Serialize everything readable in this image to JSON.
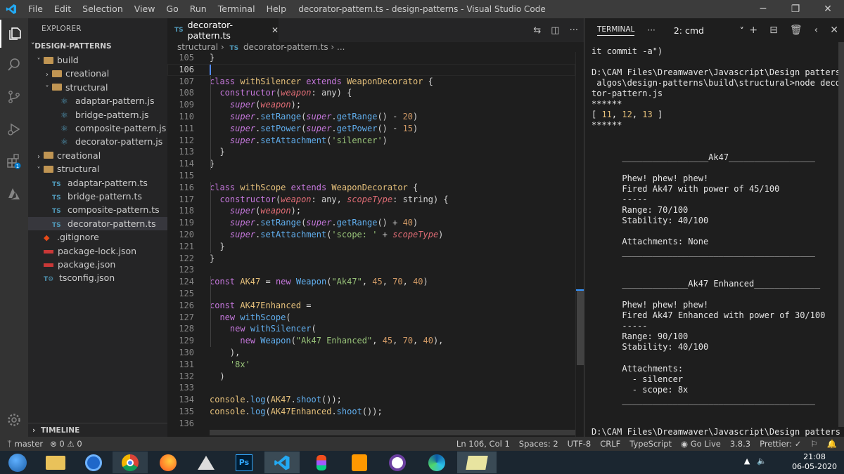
{
  "titlebar": {
    "menu": [
      "File",
      "Edit",
      "Selection",
      "View",
      "Go",
      "Run",
      "Terminal",
      "Help"
    ],
    "window_title": "decorator-pattern.ts - design-patterns - Visual Studio Code",
    "minimize": "─",
    "restore": "❐",
    "close": "✕"
  },
  "sidebar": {
    "header": "EXPLORER",
    "section": "DESIGN-PATTERNS",
    "timeline": "TIMELINE",
    "tree": [
      {
        "label": "build",
        "kind": "folder",
        "open": true,
        "depth": 1
      },
      {
        "label": "creational",
        "kind": "folder",
        "open": false,
        "depth": 2
      },
      {
        "label": "structural",
        "kind": "folder",
        "open": true,
        "depth": 2
      },
      {
        "label": "adaptar-pattern.js",
        "kind": "js",
        "depth": 3
      },
      {
        "label": "bridge-pattern.js",
        "kind": "js",
        "depth": 3
      },
      {
        "label": "composite-pattern.js",
        "kind": "js",
        "depth": 3
      },
      {
        "label": "decorator-pattern.js",
        "kind": "js",
        "depth": 3
      },
      {
        "label": "creational",
        "kind": "folder",
        "open": false,
        "depth": 1
      },
      {
        "label": "structural",
        "kind": "folder",
        "open": true,
        "depth": 1
      },
      {
        "label": "adaptar-pattern.ts",
        "kind": "ts",
        "depth": 2
      },
      {
        "label": "bridge-pattern.ts",
        "kind": "ts",
        "depth": 2
      },
      {
        "label": "composite-pattern.ts",
        "kind": "ts",
        "depth": 2
      },
      {
        "label": "decorator-pattern.ts",
        "kind": "ts",
        "depth": 2,
        "selected": true
      },
      {
        "label": ".gitignore",
        "kind": "git",
        "depth": 1
      },
      {
        "label": "package-lock.json",
        "kind": "npm",
        "depth": 1
      },
      {
        "label": "package.json",
        "kind": "npm",
        "depth": 1
      },
      {
        "label": "tsconfig.json",
        "kind": "tsconfig",
        "depth": 1
      }
    ]
  },
  "editor": {
    "tab_label": "decorator-pattern.ts",
    "tab_icon": "TS",
    "breadcrumb": [
      "structural",
      "decorator-pattern.ts",
      "..."
    ],
    "current_line": "106",
    "lines": [
      {
        "n": "105",
        "tokens": [
          [
            "pln",
            "}"
          ]
        ]
      },
      {
        "n": "106",
        "tokens": []
      },
      {
        "n": "107",
        "tokens": [
          [
            "kw",
            "class "
          ],
          [
            "cls",
            "withSilencer "
          ],
          [
            "kw",
            "extends "
          ],
          [
            "cls",
            "WeaponDecorator "
          ],
          [
            "pln",
            "{"
          ]
        ]
      },
      {
        "n": "108",
        "tokens": [
          [
            "pln",
            "  "
          ],
          [
            "kw",
            "constructor"
          ],
          [
            "pln",
            "("
          ],
          [
            "it",
            "weapon"
          ],
          [
            "pln",
            ": "
          ],
          [
            "pln",
            "any) {"
          ]
        ]
      },
      {
        "n": "109",
        "tokens": [
          [
            "pln",
            "    "
          ],
          [
            "sup",
            "super"
          ],
          [
            "pln",
            "("
          ],
          [
            "it",
            "weapon"
          ],
          [
            "pln",
            ");"
          ]
        ]
      },
      {
        "n": "110",
        "tokens": [
          [
            "pln",
            "    "
          ],
          [
            "sup",
            "super"
          ],
          [
            "pln",
            "."
          ],
          [
            "fn",
            "setRange"
          ],
          [
            "pln",
            "("
          ],
          [
            "sup",
            "super"
          ],
          [
            "pln",
            "."
          ],
          [
            "fn",
            "getRange"
          ],
          [
            "pln",
            "() - "
          ],
          [
            "num",
            "20"
          ],
          [
            "pln",
            ")"
          ]
        ]
      },
      {
        "n": "111",
        "tokens": [
          [
            "pln",
            "    "
          ],
          [
            "sup",
            "super"
          ],
          [
            "pln",
            "."
          ],
          [
            "fn",
            "setPower"
          ],
          [
            "pln",
            "("
          ],
          [
            "sup",
            "super"
          ],
          [
            "pln",
            "."
          ],
          [
            "fn",
            "getPower"
          ],
          [
            "pln",
            "() - "
          ],
          [
            "num",
            "15"
          ],
          [
            "pln",
            ")"
          ]
        ]
      },
      {
        "n": "112",
        "tokens": [
          [
            "pln",
            "    "
          ],
          [
            "sup",
            "super"
          ],
          [
            "pln",
            "."
          ],
          [
            "fn",
            "setAttachment"
          ],
          [
            "pln",
            "("
          ],
          [
            "str",
            "'silencer'"
          ],
          [
            "pln",
            ")"
          ]
        ]
      },
      {
        "n": "113",
        "tokens": [
          [
            "pln",
            "  }"
          ]
        ]
      },
      {
        "n": "114",
        "tokens": [
          [
            "pln",
            "}"
          ]
        ]
      },
      {
        "n": "115",
        "tokens": []
      },
      {
        "n": "116",
        "tokens": [
          [
            "kw",
            "class "
          ],
          [
            "cls",
            "withScope "
          ],
          [
            "kw",
            "extends "
          ],
          [
            "cls",
            "WeaponDecorator "
          ],
          [
            "pln",
            "{"
          ]
        ]
      },
      {
        "n": "117",
        "tokens": [
          [
            "pln",
            "  "
          ],
          [
            "kw",
            "constructor"
          ],
          [
            "pln",
            "("
          ],
          [
            "it",
            "weapon"
          ],
          [
            "pln",
            ": any, "
          ],
          [
            "it",
            "scopeType"
          ],
          [
            "pln",
            ": string) {"
          ]
        ]
      },
      {
        "n": "118",
        "tokens": [
          [
            "pln",
            "    "
          ],
          [
            "sup",
            "super"
          ],
          [
            "pln",
            "("
          ],
          [
            "it",
            "weapon"
          ],
          [
            "pln",
            ");"
          ]
        ]
      },
      {
        "n": "119",
        "tokens": [
          [
            "pln",
            "    "
          ],
          [
            "sup",
            "super"
          ],
          [
            "pln",
            "."
          ],
          [
            "fn",
            "setRange"
          ],
          [
            "pln",
            "("
          ],
          [
            "sup",
            "super"
          ],
          [
            "pln",
            "."
          ],
          [
            "fn",
            "getRange"
          ],
          [
            "pln",
            "() + "
          ],
          [
            "num",
            "40"
          ],
          [
            "pln",
            ")"
          ]
        ]
      },
      {
        "n": "120",
        "tokens": [
          [
            "pln",
            "    "
          ],
          [
            "sup",
            "super"
          ],
          [
            "pln",
            "."
          ],
          [
            "fn",
            "setAttachment"
          ],
          [
            "pln",
            "("
          ],
          [
            "str",
            "'scope: '"
          ],
          [
            "pln",
            " + "
          ],
          [
            "it",
            "scopeType"
          ],
          [
            "pln",
            ")"
          ]
        ]
      },
      {
        "n": "121",
        "tokens": [
          [
            "pln",
            "  }"
          ]
        ]
      },
      {
        "n": "122",
        "tokens": [
          [
            "pln",
            "}"
          ]
        ]
      },
      {
        "n": "123",
        "tokens": []
      },
      {
        "n": "124",
        "tokens": [
          [
            "kw",
            "const "
          ],
          [
            "var",
            "AK47"
          ],
          [
            "pln",
            " = "
          ],
          [
            "kw",
            "new "
          ],
          [
            "fn",
            "Weapon"
          ],
          [
            "pln",
            "("
          ],
          [
            "str",
            "\"Ak47\""
          ],
          [
            "pln",
            ", "
          ],
          [
            "num",
            "45"
          ],
          [
            "pln",
            ", "
          ],
          [
            "num",
            "70"
          ],
          [
            "pln",
            ", "
          ],
          [
            "num",
            "40"
          ],
          [
            "pln",
            ")"
          ]
        ]
      },
      {
        "n": "125",
        "tokens": []
      },
      {
        "n": "126",
        "tokens": [
          [
            "kw",
            "const "
          ],
          [
            "var",
            "AK47Enhanced"
          ],
          [
            "pln",
            " ="
          ]
        ]
      },
      {
        "n": "127",
        "tokens": [
          [
            "pln",
            "  "
          ],
          [
            "kw",
            "new "
          ],
          [
            "fn",
            "withScope"
          ],
          [
            "pln",
            "("
          ]
        ]
      },
      {
        "n": "128",
        "tokens": [
          [
            "pln",
            "    "
          ],
          [
            "kw",
            "new "
          ],
          [
            "fn",
            "withSilencer"
          ],
          [
            "pln",
            "("
          ]
        ]
      },
      {
        "n": "129",
        "tokens": [
          [
            "pln",
            "      "
          ],
          [
            "kw",
            "new "
          ],
          [
            "fn",
            "Weapon"
          ],
          [
            "pln",
            "("
          ],
          [
            "str",
            "\"Ak47 Enhanced\""
          ],
          [
            "pln",
            ", "
          ],
          [
            "num",
            "45"
          ],
          [
            "pln",
            ", "
          ],
          [
            "num",
            "70"
          ],
          [
            "pln",
            ", "
          ],
          [
            "num",
            "40"
          ],
          [
            "pln",
            "),"
          ]
        ]
      },
      {
        "n": "130",
        "tokens": [
          [
            "pln",
            "    ),"
          ]
        ]
      },
      {
        "n": "131",
        "tokens": [
          [
            "pln",
            "    "
          ],
          [
            "str",
            "'8x'"
          ]
        ]
      },
      {
        "n": "132",
        "tokens": [
          [
            "pln",
            "  )"
          ]
        ]
      },
      {
        "n": "133",
        "tokens": []
      },
      {
        "n": "134",
        "tokens": [
          [
            "con",
            "console"
          ],
          [
            "pln",
            "."
          ],
          [
            "fn",
            "log"
          ],
          [
            "pln",
            "("
          ],
          [
            "var",
            "AK47"
          ],
          [
            "pln",
            "."
          ],
          [
            "fn",
            "shoot"
          ],
          [
            "pln",
            "());"
          ]
        ]
      },
      {
        "n": "135",
        "tokens": [
          [
            "con",
            "console"
          ],
          [
            "pln",
            "."
          ],
          [
            "fn",
            "log"
          ],
          [
            "pln",
            "("
          ],
          [
            "var",
            "AK47Enhanced"
          ],
          [
            "pln",
            "."
          ],
          [
            "fn",
            "shoot"
          ],
          [
            "pln",
            "());"
          ]
        ]
      },
      {
        "n": "136",
        "tokens": []
      }
    ]
  },
  "terminal": {
    "tab_label": "TERMINAL",
    "more": "···",
    "shell_select": "2: cmd",
    "lines": [
      "it commit -a\")",
      "",
      "D:\\CAM Files\\Dreamwaver\\Javascript\\Design patters &",
      " algos\\design-patterns\\build\\structural>node decora",
      "tor-pattern.js",
      "******",
      "[ 11, 12, 13 ]",
      "******",
      "",
      "",
      "      _________________Ak47_________________",
      "",
      "      Phew! phew! phew!",
      "      Fired Ak47 with power of 45/100",
      "      -----",
      "      Range: 70/100",
      "      Stability: 40/100",
      "",
      "      Attachments: None",
      "      ______________________________________",
      "",
      "",
      "      _____________Ak47 Enhanced_____________",
      "",
      "      Phew! phew! phew!",
      "      Fired Ak47 Enhanced with power of 30/100",
      "      -----",
      "      Range: 90/100",
      "      Stability: 40/100",
      "",
      "      Attachments:",
      "        - silencer",
      "        - scope: 8x",
      "      ______________________________________",
      "",
      "",
      "D:\\CAM Files\\Dreamwaver\\Javascript\\Design patters &",
      " algos\\design-patterns\\build\\structural>"
    ]
  },
  "statusbar": {
    "branch": "master",
    "errors": "0",
    "warnings": "0",
    "position": "Ln 106, Col 1",
    "spaces": "Spaces: 2",
    "encoding": "UTF-8",
    "eol": "CRLF",
    "language": "TypeScript",
    "golive": "Go Live",
    "version": "3.8.3",
    "prettier": "Prettier: ✓"
  },
  "taskbar": {
    "time": "21:08",
    "date": "06-05-2020"
  },
  "colors": {
    "activitybar": "#333333",
    "sidebar": "#252526",
    "editor": "#1e1e1e",
    "ts_icon": "#519aba"
  }
}
